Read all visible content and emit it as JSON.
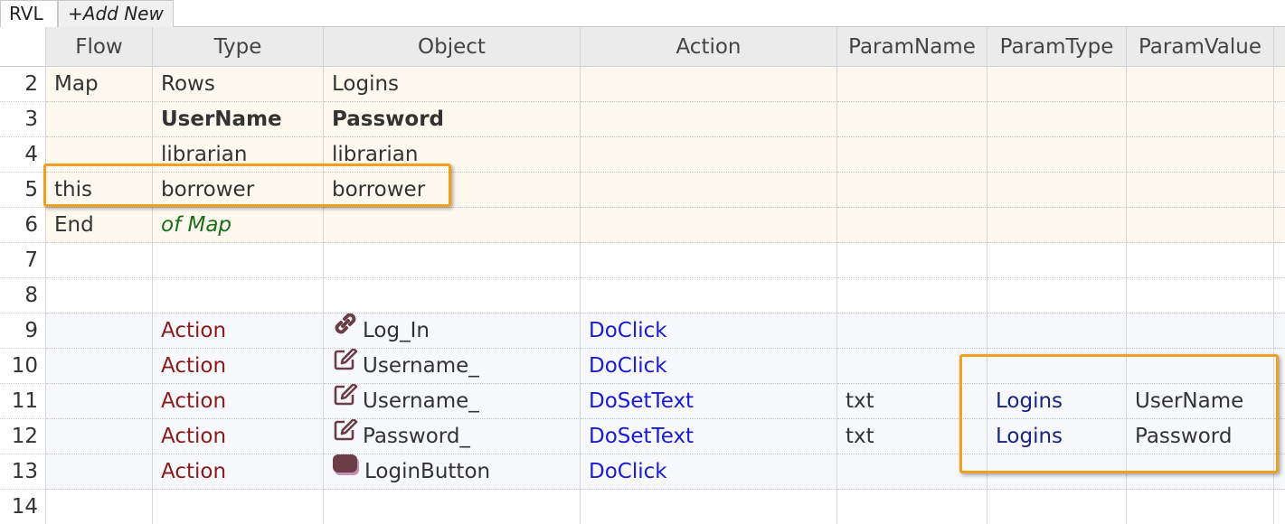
{
  "tabs": [
    {
      "label": "RVL"
    },
    {
      "label": "+Add New"
    }
  ],
  "columns": [
    "Flow",
    "Type",
    "Object",
    "Action",
    "ParamName",
    "ParamType",
    "ParamValue"
  ],
  "rows": [
    {
      "num": "2",
      "flow": "Map",
      "type": "Rows",
      "object": "Logins",
      "action": "",
      "paramName": "",
      "paramType": "",
      "paramValue": ""
    },
    {
      "num": "3",
      "flow": "",
      "type": "UserName",
      "object": "Password",
      "action": "",
      "paramName": "",
      "paramType": "",
      "paramValue": ""
    },
    {
      "num": "4",
      "flow": "",
      "type": "librarian",
      "object": "librarian",
      "action": "",
      "paramName": "",
      "paramType": "",
      "paramValue": ""
    },
    {
      "num": "5",
      "flow": "this",
      "type": "borrower",
      "object": "borrower",
      "action": "",
      "paramName": "",
      "paramType": "",
      "paramValue": ""
    },
    {
      "num": "6",
      "flow": "End",
      "type": "of Map",
      "object": "",
      "action": "",
      "paramName": "",
      "paramType": "",
      "paramValue": ""
    },
    {
      "num": "7",
      "flow": "",
      "type": "",
      "object": "",
      "action": "",
      "paramName": "",
      "paramType": "",
      "paramValue": ""
    },
    {
      "num": "8",
      "flow": "",
      "type": "",
      "object": "",
      "action": "",
      "paramName": "",
      "paramType": "",
      "paramValue": ""
    },
    {
      "num": "9",
      "flow": "",
      "type": "Action",
      "object": "Log_In",
      "objectIcon": "link-icon",
      "action": "DoClick",
      "paramName": "",
      "paramType": "",
      "paramValue": ""
    },
    {
      "num": "10",
      "flow": "",
      "type": "Action",
      "object": "Username_",
      "objectIcon": "edit-icon",
      "action": "DoClick",
      "paramName": "",
      "paramType": "",
      "paramValue": ""
    },
    {
      "num": "11",
      "flow": "",
      "type": "Action",
      "object": "Username_",
      "objectIcon": "edit-icon",
      "action": "DoSetText",
      "paramName": "txt",
      "paramType": "Logins",
      "paramValue": "UserName"
    },
    {
      "num": "12",
      "flow": "",
      "type": "Action",
      "object": "Password_",
      "objectIcon": "edit-icon",
      "action": "DoSetText",
      "paramName": "txt",
      "paramType": "Logins",
      "paramValue": "Password"
    },
    {
      "num": "13",
      "flow": "",
      "type": "Action",
      "object": "LoginButton",
      "objectIcon": "button-icon",
      "action": "DoClick",
      "paramName": "",
      "paramType": "",
      "paramValue": ""
    },
    {
      "num": "14",
      "flow": "",
      "type": "",
      "object": "",
      "action": "",
      "paramName": "",
      "paramType": "",
      "paramValue": ""
    }
  ],
  "colors": {
    "highlight": "#f0a020",
    "action_keyword": "#8b1a1a",
    "method": "#1a1ad6",
    "map_comment": "#1b6e1b",
    "map_row_bg": "#fdf9ee"
  }
}
